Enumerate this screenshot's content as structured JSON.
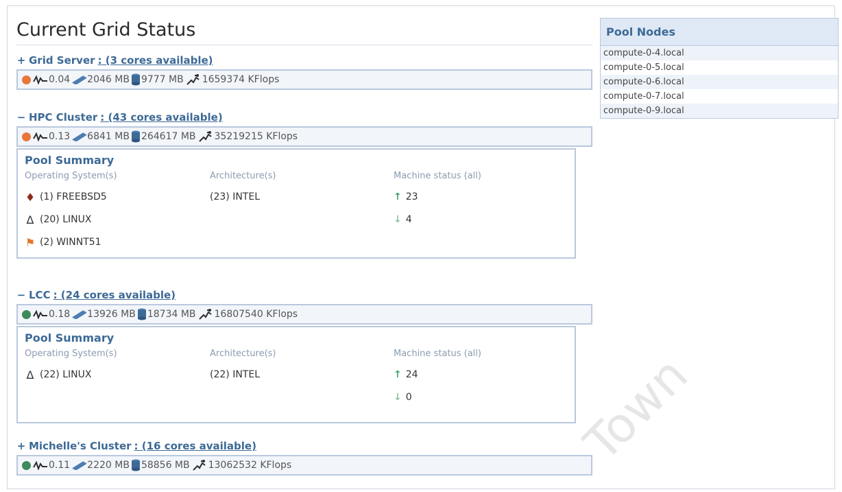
{
  "title": "Current Grid Status",
  "sections": [
    {
      "toggle": "+",
      "name": "Grid Server",
      "cores": ": (3 cores available)",
      "status": "orange",
      "load": "0.04",
      "mem": "2046 MB",
      "disk": "9777 MB",
      "flops": "1659374 KFlops"
    },
    {
      "toggle": "−",
      "name": "HPC Cluster",
      "cores": ": (43 cores available)",
      "status": "orange",
      "load": "0.13",
      "mem": "6841 MB",
      "disk": "264617 MB",
      "flops": "35219215 KFlops",
      "summary": {
        "title": "Pool Summary",
        "os_head": "Operating System(s)",
        "arch_head": "Architecture(s)",
        "status_head": "Machine status (all)",
        "os": [
          "(1) FREEBSD5",
          "(20) LINUX",
          "(2) WINNT51"
        ],
        "arch": [
          "(23) INTEL"
        ],
        "up": "23",
        "down": "4"
      }
    },
    {
      "toggle": "−",
      "name": "LCC",
      "cores": ": (24 cores available)",
      "status": "green",
      "load": "0.18",
      "mem": "13926 MB",
      "disk": "18734 MB",
      "flops": "16807540 KFlops",
      "summary": {
        "title": "Pool Summary",
        "os_head": "Operating System(s)",
        "arch_head": "Architecture(s)",
        "status_head": "Machine status (all)",
        "os": [
          "(22) LINUX"
        ],
        "arch": [
          "(22) INTEL"
        ],
        "up": "24",
        "down": "0"
      }
    },
    {
      "toggle": "+",
      "name": "Michelle's Cluster",
      "cores": ": (16 cores available)",
      "status": "green",
      "load": "0.11",
      "mem": "2220 MB",
      "disk": "58856 MB",
      "flops": "13062532 KFlops"
    }
  ],
  "pool_nodes": {
    "title": "Pool Nodes",
    "items": [
      "compute-0-4.local",
      "compute-0-5.local",
      "compute-0-6.local",
      "compute-0-7.local",
      "compute-0-9.local"
    ]
  },
  "colors": {
    "orange": "#e8773a",
    "green": "#3f8a5a",
    "accent": "#3d6a96"
  },
  "watermark": "Town"
}
